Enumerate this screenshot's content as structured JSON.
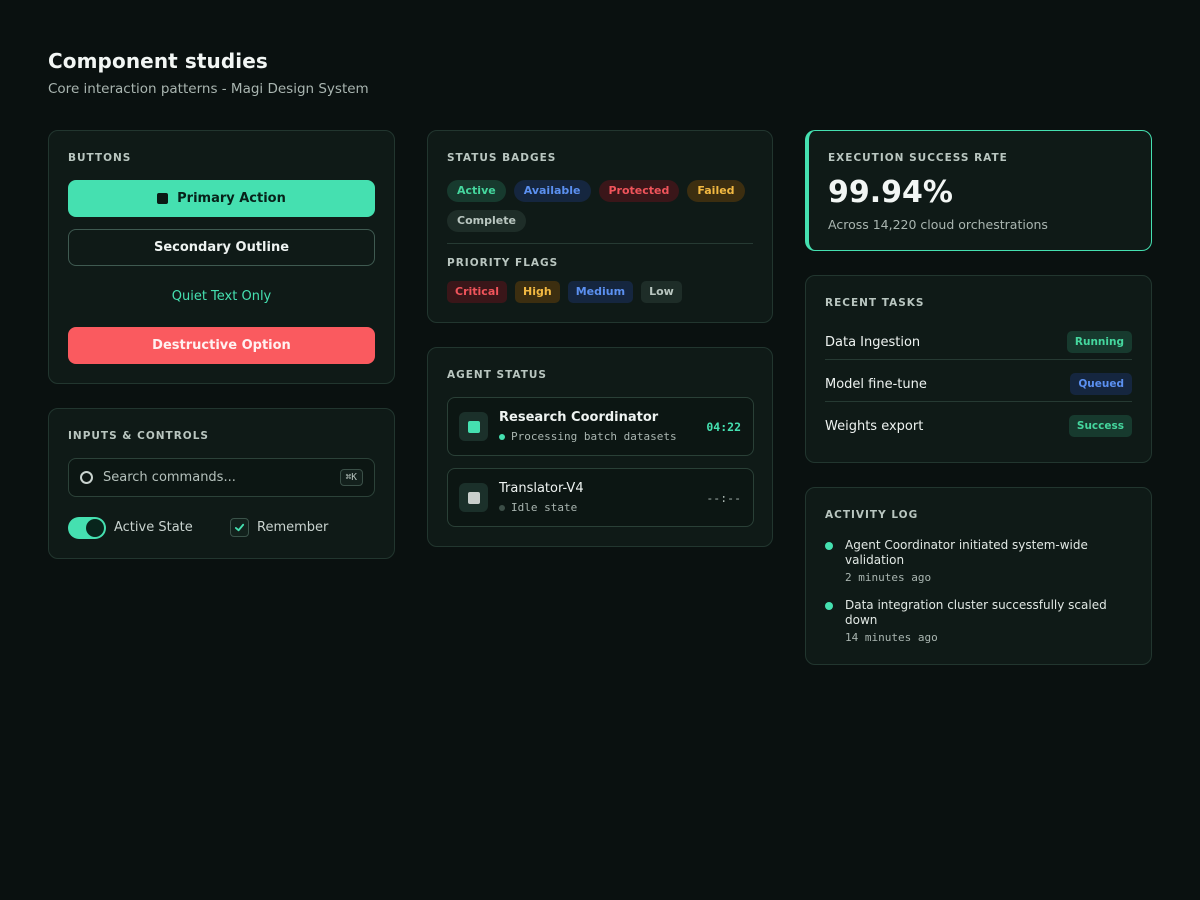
{
  "header": {
    "title": "Component studies",
    "subtitle": "Core interaction patterns - Magi Design System"
  },
  "buttons_card": {
    "label": "BUTTONS",
    "primary": "Primary Action",
    "secondary": "Secondary Outline",
    "quiet": "Quiet Text Only",
    "destructive": "Destructive Option"
  },
  "inputs_card": {
    "label": "INPUTS & CONTROLS",
    "search_placeholder": "Search commands...",
    "shortcut": "⌘K",
    "toggle_label": "Active State",
    "toggle_on": true,
    "checkbox_label": "Remember",
    "checkbox_checked": true
  },
  "badges_card": {
    "label": "STATUS BADGES",
    "badges": [
      "Active",
      "Available",
      "Protected",
      "Failed",
      "Complete"
    ],
    "flags_label": "PRIORITY FLAGS",
    "flags": [
      "Critical",
      "High",
      "Medium",
      "Low"
    ]
  },
  "agent_card": {
    "label": "AGENT STATUS",
    "agents": [
      {
        "name": "Research Coordinator",
        "status": "Processing batch datasets",
        "time": "04:22"
      },
      {
        "name": "Translator-V4",
        "status": "Idle state",
        "time": "--:--"
      }
    ]
  },
  "metric_card": {
    "label": "EXECUTION SUCCESS RATE",
    "value": "99.94%",
    "caption": "Across 14,220 cloud orchestrations"
  },
  "tasks_card": {
    "label": "RECENT TASKS",
    "tasks": [
      {
        "name": "Data Ingestion",
        "status": "Running"
      },
      {
        "name": "Model fine-tune",
        "status": "Queued"
      },
      {
        "name": "Weights export",
        "status": "Success"
      }
    ]
  },
  "activity_card": {
    "label": "ACTIVITY LOG",
    "entries": [
      {
        "text": "Agent Coordinator initiated system-wide validation",
        "time": "2 minutes ago"
      },
      {
        "text": "Data integration cluster successfully scaled down",
        "time": "14 minutes ago"
      }
    ]
  },
  "colors": {
    "accent": "#45e0b0",
    "danger": "#fa5a5f",
    "background": "#0a1110",
    "card": "#0f1a17"
  }
}
